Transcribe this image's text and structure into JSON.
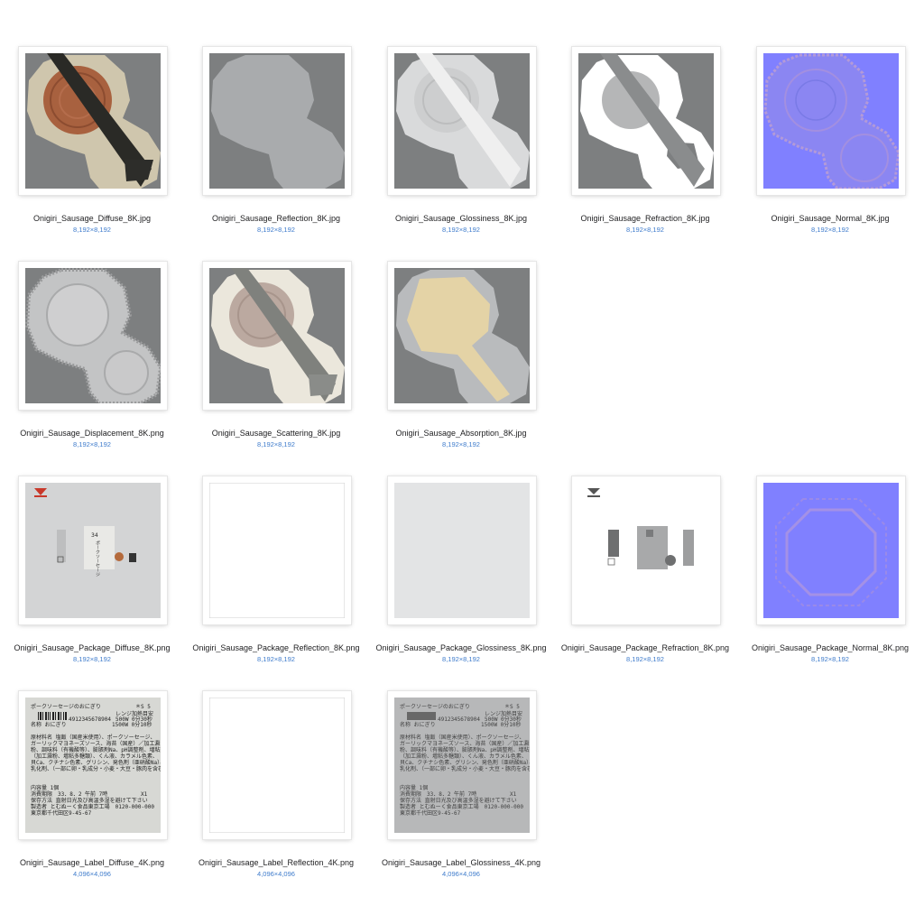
{
  "files": [
    {
      "name": "Onigiri_Sausage_Diffuse_8K.jpg",
      "size": "8,192×8,192",
      "kind": "diffuse"
    },
    {
      "name": "Onigiri_Sausage_Reflection_8K.jpg",
      "size": "8,192×8,192",
      "kind": "reflection"
    },
    {
      "name": "Onigiri_Sausage_Glossiness_8K.jpg",
      "size": "8,192×8,192",
      "kind": "glossiness"
    },
    {
      "name": "Onigiri_Sausage_Refraction_8K.jpg",
      "size": "8,192×8,192",
      "kind": "refraction"
    },
    {
      "name": "Onigiri_Sausage_Normal_8K.jpg",
      "size": "8,192×8,192",
      "kind": "normal"
    },
    {
      "name": "Onigiri_Sausage_Displacement_8K.png",
      "size": "8,192×8,192",
      "kind": "displacement"
    },
    {
      "name": "Onigiri_Sausage_Scattering_8K.jpg",
      "size": "8,192×8,192",
      "kind": "scattering"
    },
    {
      "name": "Onigiri_Sausage_Absorption_8K.jpg",
      "size": "8,192×8,192",
      "kind": "absorption"
    },
    {
      "name": "Onigiri_Sausage_Package_Diffuse_8K.png",
      "size": "8,192×8,192",
      "kind": "pkg-diffuse"
    },
    {
      "name": "Onigiri_Sausage_Package_Reflection_8K.png",
      "size": "8,192×8,192",
      "kind": "pkg-reflection"
    },
    {
      "name": "Onigiri_Sausage_Package_Glossiness_8K.png",
      "size": "8,192×8,192",
      "kind": "pkg-glossiness"
    },
    {
      "name": "Onigiri_Sausage_Package_Refraction_8K.png",
      "size": "8,192×8,192",
      "kind": "pkg-refraction"
    },
    {
      "name": "Onigiri_Sausage_Package_Normal_8K.png",
      "size": "8,192×8,192",
      "kind": "pkg-normal"
    },
    {
      "name": "Onigiri_Sausage_Label_Diffuse_4K.png",
      "size": "4,096×4,096",
      "kind": "label-diffuse"
    },
    {
      "name": "Onigiri_Sausage_Label_Reflection_4K.png",
      "size": "4,096×4,096",
      "kind": "label-reflection"
    },
    {
      "name": "Onigiri_Sausage_Label_Glossiness_4K.png",
      "size": "4,096×4,096",
      "kind": "label-glossiness"
    }
  ],
  "package_text": {
    "vertical": "ポークソーセージ",
    "number": "34"
  },
  "label": {
    "title": "ポークソーセージのおにぎり",
    "code": "＊S 5",
    "range_heading": "レンジ加熱目安",
    "range_500": "500W 0分30秒",
    "range_1500": "1500W 0分10秒",
    "barcode_number": "4912345678904",
    "name_line": "名称 おにぎり",
    "ingredients": [
      "原材料名 塩飯（国産米使用）、ポークソーセージ、",
      "ガーリックマヨネーズソース、海苔（国産）／加工澱",
      "粉、調味料（有機酸等）、膨脹剤Na、pH調整剤、増粘剤",
      "（加工澱粉、増粘多糖類）、くん液、カラメル色素、",
      "貝Ca、クチナシ色素、グリシン、発色剤（亜硝酸Na）、",
      "乳化剤、（一部に卵・乳成分・小麦・大豆・豚肉を含む）"
    ],
    "content": "内容量 1個",
    "expiry": "消費期限　33．8．2 午前 7時",
    "expiry_mark": "X1",
    "storage": "保存方法 直射日光及び高温多湿を避けて下さい",
    "maker": "製造者 とむぬーく食品東京工場　0120-000-000",
    "address": "東京都千代田区9-45-67"
  },
  "colors": {
    "background_gray": "#7d7f80",
    "normal_blue": "#8080ff",
    "rice_beige": "#cfc6ad",
    "sausage_brown": "#9a5a3c",
    "nori_black": "#2a2a26",
    "size_text_blue": "#3f7ccc"
  }
}
